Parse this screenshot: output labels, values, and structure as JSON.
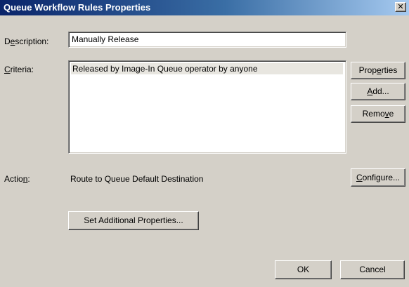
{
  "window": {
    "title": "Queue Workflow Rules Properties",
    "close_glyph": "✕"
  },
  "description": {
    "label_pre": "D",
    "label_key": "e",
    "label_post": "scription:",
    "value": "Manually Release"
  },
  "criteria": {
    "label_key": "C",
    "label_post": "riteria:",
    "items": [
      "Released by Image-In Queue operator by anyone"
    ],
    "buttons": {
      "properties": {
        "pre": "Prop",
        "key": "e",
        "post": "rties"
      },
      "add": {
        "pre": "",
        "key": "A",
        "post": "dd..."
      },
      "remove": {
        "pre": "Remo",
        "key": "v",
        "post": "e"
      }
    }
  },
  "action": {
    "label_pre": "Actio",
    "label_key": "n",
    "label_post": ":",
    "value": "Route to Queue Default Destination",
    "configure": {
      "pre": "",
      "key": "C",
      "post": "onfigure..."
    }
  },
  "set_additional_label": "Set Additional Properties...",
  "footer": {
    "ok": "OK",
    "cancel": "Cancel"
  },
  "colors": {
    "dialog_bg": "#d4d0c8",
    "title_start": "#0a246a",
    "title_end": "#a6caf0",
    "selected_row": "#e8e6e0"
  }
}
